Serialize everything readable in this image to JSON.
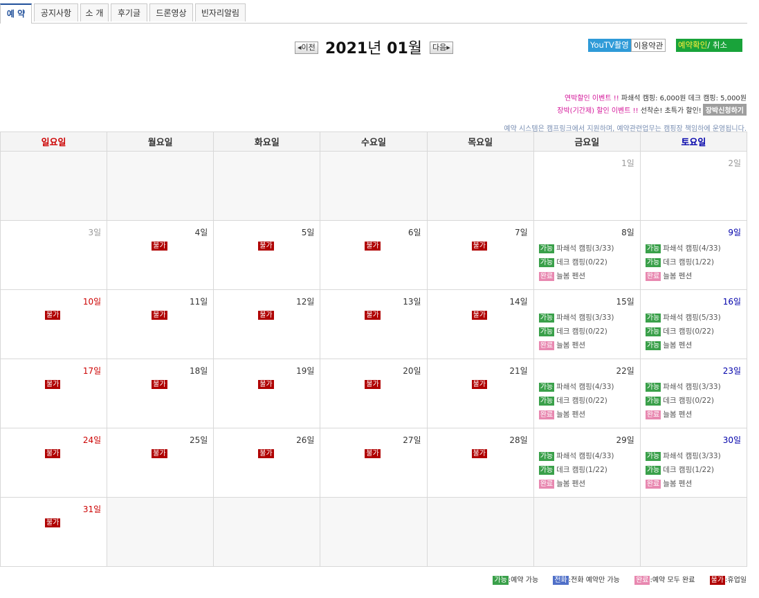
{
  "tabs": [
    "예 약",
    "공지사항",
    "소 개",
    "후기글",
    "드론영상",
    "빈자리알림"
  ],
  "nav": {
    "prev": "이전",
    "next": "다음",
    "year": "2021",
    "year_unit": "년",
    "month": "01",
    "month_unit": "월"
  },
  "buttons": {
    "youtv": "YouTV촬영",
    "terms": "이용약관",
    "confirm": "예약확인",
    "cancel": "/ 취소"
  },
  "notices": {
    "line1_event": "연박할인 이벤트 !!",
    "line1_text": "파쇄석 캠핑: 6,000원 데크 캠핑: 5,000원",
    "line2_event": "장박(기간제) 할인 이벤트 !!",
    "line2_text": "선착순! 초특가 할인!",
    "line2_button": "장박신청하기",
    "system": "예약 시스템은 캠프링크에서 지원하며, 예약관련업무는 캠핑장 책임하에 운영됩니다."
  },
  "weekdays": [
    "일요일",
    "월요일",
    "화요일",
    "수요일",
    "목요일",
    "금요일",
    "토요일"
  ],
  "badge_labels": {
    "ok": "가능",
    "no": "불가",
    "done": "완료",
    "tel": "전화"
  },
  "calendar_weeks": [
    [
      null,
      null,
      null,
      null,
      null,
      {
        "day": "1일",
        "past": true
      },
      {
        "day": "2일",
        "past": true
      }
    ],
    [
      {
        "day": "3일",
        "past": true
      },
      {
        "day": "4일",
        "status": "불가"
      },
      {
        "day": "5일",
        "status": "불가"
      },
      {
        "day": "6일",
        "status": "불가"
      },
      {
        "day": "7일",
        "status": "불가"
      },
      {
        "day": "8일",
        "slots": [
          {
            "badge": "가능",
            "text": "파쇄석 캠핑(3/33)"
          },
          {
            "badge": "가능",
            "text": "데크 캠핑(0/22)"
          },
          {
            "badge": "완료",
            "text": "늘봄 펜션"
          }
        ]
      },
      {
        "day": "9일",
        "slots": [
          {
            "badge": "가능",
            "text": "파쇄석 캠핑(4/33)"
          },
          {
            "badge": "가능",
            "text": "데크 캠핑(1/22)"
          },
          {
            "badge": "완료",
            "text": "늘봄 펜션"
          }
        ]
      }
    ],
    [
      {
        "day": "10일",
        "status": "불가"
      },
      {
        "day": "11일",
        "status": "불가"
      },
      {
        "day": "12일",
        "status": "불가"
      },
      {
        "day": "13일",
        "status": "불가"
      },
      {
        "day": "14일",
        "status": "불가"
      },
      {
        "day": "15일",
        "slots": [
          {
            "badge": "가능",
            "text": "파쇄석 캠핑(3/33)"
          },
          {
            "badge": "가능",
            "text": "데크 캠핑(0/22)"
          },
          {
            "badge": "완료",
            "text": "늘봄 펜션"
          }
        ]
      },
      {
        "day": "16일",
        "slots": [
          {
            "badge": "가능",
            "text": "파쇄석 캠핑(5/33)"
          },
          {
            "badge": "가능",
            "text": "데크 캠핑(0/22)"
          },
          {
            "badge": "가능",
            "text": "늘봄 펜션"
          }
        ]
      }
    ],
    [
      {
        "day": "17일",
        "status": "불가"
      },
      {
        "day": "18일",
        "status": "불가"
      },
      {
        "day": "19일",
        "status": "불가"
      },
      {
        "day": "20일",
        "status": "불가"
      },
      {
        "day": "21일",
        "status": "불가"
      },
      {
        "day": "22일",
        "slots": [
          {
            "badge": "가능",
            "text": "파쇄석 캠핑(4/33)"
          },
          {
            "badge": "가능",
            "text": "데크 캠핑(0/22)"
          },
          {
            "badge": "완료",
            "text": "늘봄 펜션"
          }
        ]
      },
      {
        "day": "23일",
        "slots": [
          {
            "badge": "가능",
            "text": "파쇄석 캠핑(3/33)"
          },
          {
            "badge": "가능",
            "text": "데크 캠핑(0/22)"
          },
          {
            "badge": "완료",
            "text": "늘봄 펜션"
          }
        ]
      }
    ],
    [
      {
        "day": "24일",
        "status": "불가"
      },
      {
        "day": "25일",
        "status": "불가"
      },
      {
        "day": "26일",
        "status": "불가"
      },
      {
        "day": "27일",
        "status": "불가"
      },
      {
        "day": "28일",
        "status": "불가"
      },
      {
        "day": "29일",
        "slots": [
          {
            "badge": "가능",
            "text": "파쇄석 캠핑(4/33)"
          },
          {
            "badge": "가능",
            "text": "데크 캠핑(1/22)"
          },
          {
            "badge": "완료",
            "text": "늘봄 펜션"
          }
        ]
      },
      {
        "day": "30일",
        "slots": [
          {
            "badge": "가능",
            "text": "파쇄석 캠핑(3/33)"
          },
          {
            "badge": "가능",
            "text": "데크 캠핑(1/22)"
          },
          {
            "badge": "완료",
            "text": "늘봄 펜션"
          }
        ]
      }
    ],
    [
      {
        "day": "31일",
        "status": "불가"
      },
      null,
      null,
      null,
      null,
      null,
      null
    ]
  ],
  "legend": [
    {
      "badge": "가능",
      "text": ":예약 가능"
    },
    {
      "badge": "전화",
      "text": ":전화 예약만 가능"
    },
    {
      "badge": "완료",
      "text": ":예약 모두 완료"
    },
    {
      "badge": "불가",
      "text": ":휴업일"
    }
  ],
  "colors": {
    "ok": "#3aa04a",
    "no": "#b00000",
    "done": "#e888b0",
    "tel": "#5070c8",
    "sunday": "#cc0000",
    "saturday": "#0000aa",
    "youtv": "#2f9bd8",
    "confirm": "#19a33a"
  }
}
